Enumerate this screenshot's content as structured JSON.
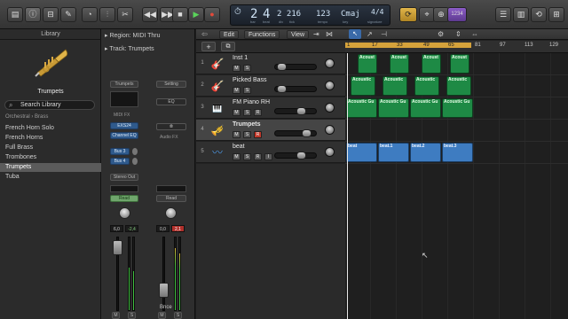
{
  "control_bar": {
    "lcd": {
      "bar": "2",
      "beat": "4",
      "division_tick": "2 216",
      "tempo": "123",
      "key": "Cmaj",
      "time_sig": "4/4",
      "labels": [
        "bar",
        "beat",
        "div",
        "tick",
        "tempo",
        "key",
        "signature"
      ]
    },
    "count_in_label": "⌖",
    "metronome_label": "⊕",
    "tuner_label": "1234"
  },
  "library": {
    "title": "Library",
    "preview_name": "Trumpets",
    "search_placeholder": "Search Library",
    "breadcrumb": "Orchestral  ›  Brass",
    "items": [
      {
        "label": "French Horn Solo"
      },
      {
        "label": "French Horns"
      },
      {
        "label": "Full Brass"
      },
      {
        "label": "Trombones"
      },
      {
        "label": "Trumpets"
      },
      {
        "label": "Tuba"
      }
    ]
  },
  "inspector": {
    "region_header": "Region:  MIDI Thru",
    "track_header": "Track:  Trumpets",
    "strip1": {
      "name_button": "Trumpets",
      "midi_fx": "MIDI FX",
      "plugins": [
        "EXS24",
        "Channel EQ"
      ],
      "sends": [
        "Bus 3",
        "Bus 4"
      ],
      "output": "Stereo Out",
      "automation": "Read",
      "volume": "6,0",
      "peak": "-2,4",
      "m": "M",
      "s": "S"
    },
    "strip2": {
      "name_button": "Setting",
      "eq": "EQ",
      "audio_fx": "Audio FX",
      "automation": "Read",
      "volume": "0,0",
      "peak": "2,1",
      "name": "Bnce",
      "m": "M",
      "s": "S"
    }
  },
  "tracks_area": {
    "menus": [
      "Edit",
      "Functions",
      "View"
    ],
    "ruler_numbers": [
      "1",
      "17",
      "33",
      "49",
      "65",
      "81",
      "97",
      "113",
      "129"
    ],
    "tracks": [
      {
        "num": "1",
        "name": "Inst 1",
        "icon": "keyboard-icon",
        "buttons": [
          "M",
          "S"
        ]
      },
      {
        "num": "2",
        "name": "Picked Bass",
        "icon": "bass-guitar-icon",
        "buttons": [
          "M",
          "S"
        ]
      },
      {
        "num": "3",
        "name": "FM Piano RH",
        "icon": "piano-icon",
        "buttons": [
          "M",
          "S",
          "R"
        ]
      },
      {
        "num": "4",
        "name": "Trumpets",
        "icon": "trumpet-icon",
        "buttons": [
          "M",
          "S",
          "R"
        ]
      },
      {
        "num": "5",
        "name": "beat",
        "icon": "waveform-icon",
        "buttons": [
          "M",
          "S",
          "R",
          "I"
        ]
      }
    ],
    "regions_row1": [
      "Acoust",
      "Acoust",
      "Acoust",
      "Acoust"
    ],
    "regions_row2": [
      "Acoustic",
      "Acoustic",
      "Acoustic",
      "Acoustic"
    ],
    "regions_row3": [
      "Acoustic Gu",
      "Acoustic Gu",
      "Acoustic Gu",
      "Acoustic Gu"
    ],
    "regions_beat": [
      "beat",
      "beat.1",
      "beat.2",
      "beat.3"
    ]
  },
  "colors": {
    "midi_region": "#1e8a45",
    "audio_region": "#3e7cc1",
    "cycle": "#d5a23b",
    "record": "#c0392b"
  }
}
